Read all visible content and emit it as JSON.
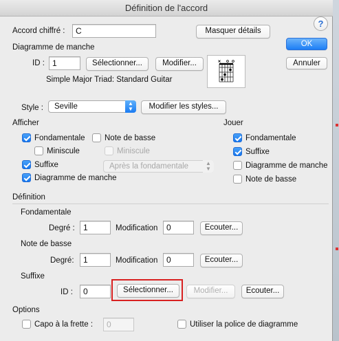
{
  "window": {
    "title": "Définition de l'accord"
  },
  "chord": {
    "label": "Accord chiffré :",
    "value": "C",
    "details_button": "Masquer détails"
  },
  "actions": {
    "ok": "OK",
    "cancel": "Annuler",
    "help": "?"
  },
  "fretboard": {
    "section": "Diagramme de manche",
    "id_label": "ID :",
    "id_value": "1",
    "select_button": "Sélectionner...",
    "modify_button": "Modifier...",
    "description": "Simple Major Triad:  Standard Guitar"
  },
  "style": {
    "label": "Style :",
    "value": "Seville",
    "modify_button": "Modifier les styles..."
  },
  "show": {
    "section": "Afficher",
    "fundamental": "Fondamentale",
    "bass_note": "Note de basse",
    "minuscule": "Miniscule",
    "minuscule_disabled": "Miniscule",
    "suffix": "Suffixe",
    "after_fundamental": "Après la fondamentale",
    "fret_diagram": "Diagramme de manche"
  },
  "play": {
    "section": "Jouer",
    "fundamental": "Fondamentale",
    "suffix": "Suffixe",
    "fret_diagram": "Diagramme de manche",
    "bass_note": "Note de basse"
  },
  "definition": {
    "section": "Définition",
    "fundamental": {
      "heading": "Fondamentale",
      "degree_label": "Degré :",
      "degree_value": "1",
      "modification_label": "Modification",
      "modification_value": "0",
      "listen_button": "Ecouter..."
    },
    "bass": {
      "heading": "Note de basse",
      "degree_label": "Degré:",
      "degree_value": "1",
      "modification_label": "Modification",
      "modification_value": "0",
      "listen_button": "Ecouter..."
    },
    "suffix": {
      "heading": "Suffixe",
      "id_label": "ID :",
      "id_value": "0",
      "select_button": "Sélectionner...",
      "modify_button": "Modifier...",
      "listen_button": "Ecouter..."
    }
  },
  "options": {
    "section": "Options",
    "capo_label": "Capo à la frette :",
    "capo_value": "0",
    "use_diagram_font": "Utiliser la police de diagramme"
  }
}
